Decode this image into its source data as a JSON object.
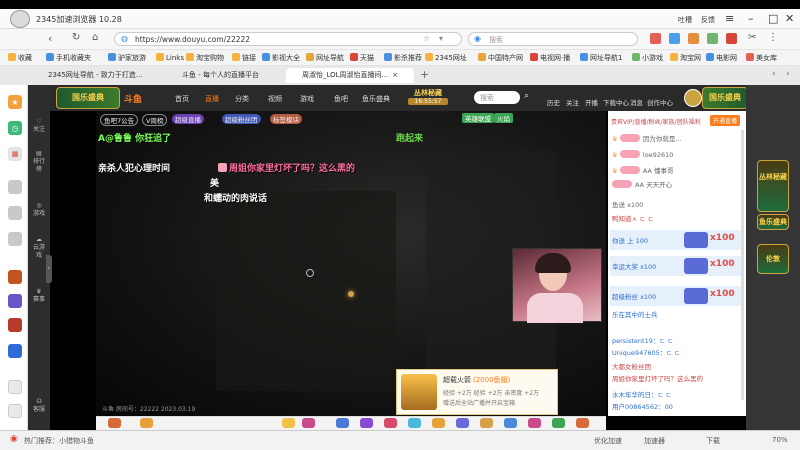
{
  "browser": {
    "title": "2345加速浏览器 10.28",
    "url": "https://www.douyu.com/22222",
    "search_placeholder": "搜索",
    "window_controls": [
      "吐槽",
      "反馈"
    ],
    "bookmarks": [
      "收藏",
      "手机收藏夹",
      "驴家旅游",
      "Links",
      "淘宝购物",
      "链接",
      "影视大全",
      "网址导航",
      "天猫",
      "影杀推荐",
      "2345网址",
      "中国特产网",
      "电视网·播",
      "网址导航1",
      "小游戏",
      "淘宝网",
      "电影网",
      "美女库"
    ],
    "tabs": [
      "2345网址导航 - 致力于打造...",
      "斗鱼 - 每个人的直播平台",
      "周淑怡_LOL周淑怡直播间..."
    ],
    "status": [
      "热门推荐：小猎物斗鱼",
      "优化加速",
      "加速器",
      "下载",
      "70%"
    ]
  },
  "browser_sidebar": [
    "star-icon",
    "clock-icon",
    "calendar-icon",
    "game-icon",
    "game-icon",
    "game-icon",
    "game-icon",
    "game-icon",
    "game-icon",
    "game-icon",
    "game-icon",
    "game-icon"
  ],
  "site_sidebar": [
    "关注",
    "排行榜",
    "游戏",
    "云游戏",
    "赛事",
    "客服"
  ],
  "site_nav": {
    "logo": "斗鱼",
    "items": [
      "首页",
      "直播",
      "分类",
      "视频",
      "游戏",
      "鱼吧",
      "鱼乐盛典"
    ],
    "event_label": "丛林秘藏",
    "event_time": "16:55:57",
    "search_placeholder": "搜索",
    "right_items": [
      "历史",
      "关注",
      "开播",
      "下载中心",
      "消息",
      "创作中心"
    ],
    "banner_text": "国乐盛典"
  },
  "video": {
    "top_tags": [
      "鱼吧7公告",
      "V周榜",
      "超级直播",
      "超级粉丝团",
      "标签模块"
    ],
    "right_tags": [
      "英雄联盟",
      "火焰"
    ],
    "brand": "跑起来",
    "danmaku": [
      "A@鲁鲁 你狂追了",
      "亲杀人犯心理时间",
      "周姐你家里灯坏了吗？这么黑的",
      "美",
      "和蠕动的肉说话"
    ],
    "footer_text": "斗鱼 房间号：22222   2023.03.19",
    "gift_popup": {
      "name": "超载火箭",
      "price": "(2000鱼翅)",
      "desc": "经验 +2万 经验 +2万 亲密度 +2万",
      "desc2": "赠送后全站广播并开启宝箱"
    }
  },
  "chat": {
    "header": "贵宾VIP/直播/粉丝/家族/团队福利",
    "header_btn": "开通直播",
    "messages": [
      "因为你就是...",
      "loe92610",
      "AA 懂事哥",
      "AA 天天开心",
      "鱼送 x100",
      "鸭知道ㅅ ㄷ ㄷ",
      "你送 上 100",
      "幸运大奖 x100",
      "乐在其中的士兵",
      "超级粉丝 x100",
      "persistent19：ㄷ ㄷ",
      "Unique947605：ㄷ ㄷ",
      "大都女粉丝团",
      "周姐你家里灯坏了吗？这么黑的",
      "水木年华的日：ㄷ ㄷ",
      "用户00864562：00"
    ]
  },
  "right_gutter": [
    "丛林秘藏",
    "鱼乐盛典",
    "伦敦"
  ]
}
